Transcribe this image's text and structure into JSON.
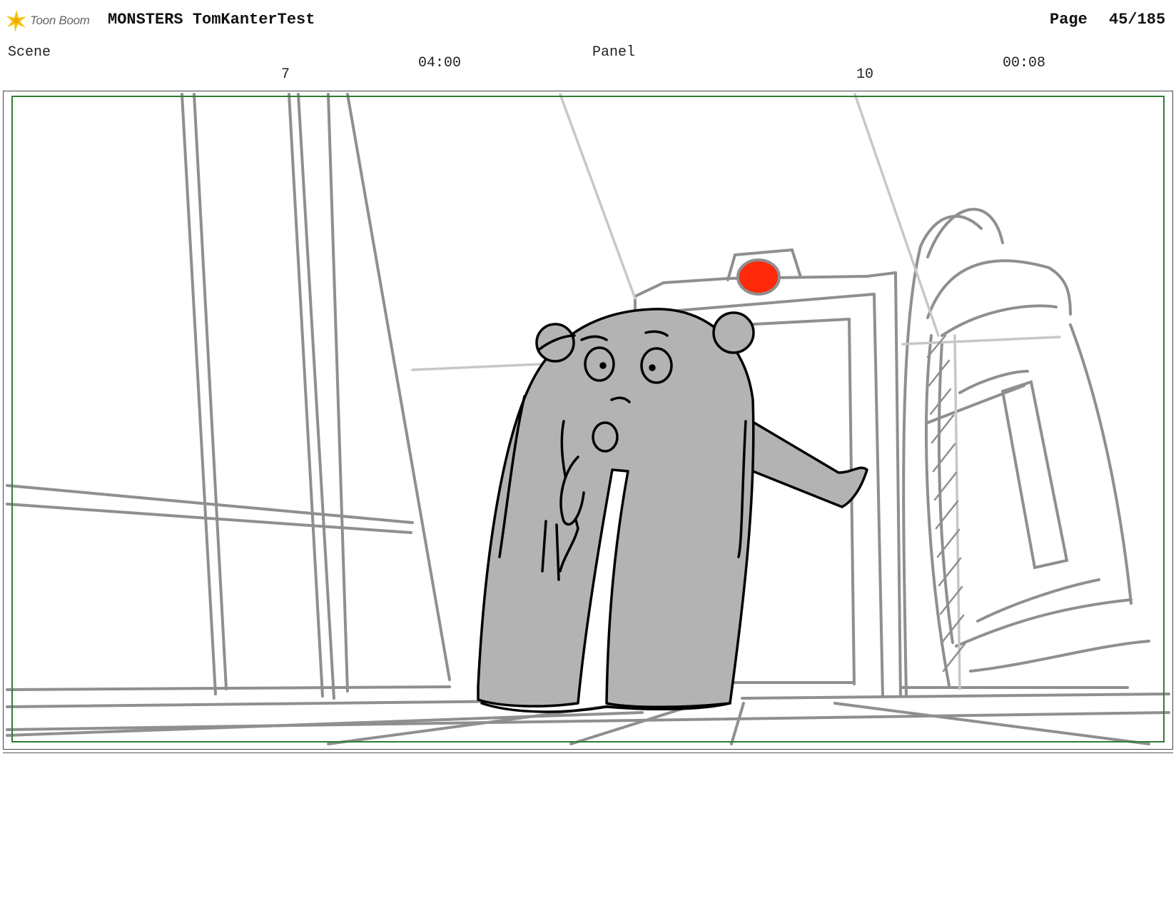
{
  "header": {
    "logo_text": "Toon Boom",
    "project_title": "MONSTERS TomKanterTest",
    "page_label": "Page",
    "page_value": "45/185"
  },
  "scene": {
    "label": "Scene",
    "number": "7",
    "duration": "04:00"
  },
  "panel": {
    "label": "Panel",
    "number": "10",
    "duration": "00:08"
  },
  "colors": {
    "safe_frame": "#2e7d32",
    "character_fill": "#b3b3b3",
    "alarm_light": "#ff2a0a",
    "sketch_lines": "#8f8f8f"
  }
}
